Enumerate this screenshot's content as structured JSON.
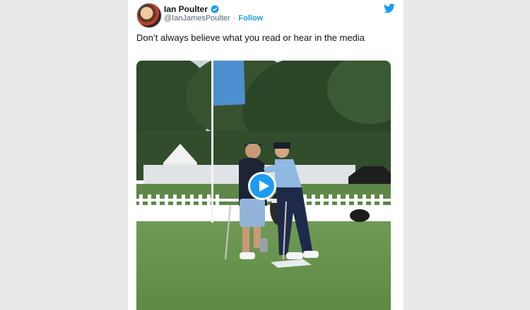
{
  "tweet": {
    "display_name": "Ian Poulter",
    "handle": "@IanJamesPoulter",
    "separator": "·",
    "follow_label": "Follow",
    "text": "Don’t always believe what you read or hear in the media",
    "media": {
      "type": "video",
      "play_icon": "play-icon"
    }
  },
  "icons": {
    "brand": "twitter-bird-icon",
    "verified": "verified-badge-icon"
  },
  "colors": {
    "accent": "#1d9bf0",
    "text": "#0f1419",
    "muted": "#536471"
  }
}
